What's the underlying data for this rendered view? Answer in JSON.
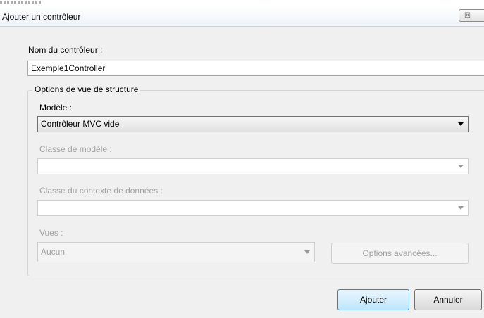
{
  "window": {
    "title": "Ajouter un contrôleur",
    "close_glyph": "☒"
  },
  "controller_name": {
    "label": "Nom du contrôleur :",
    "value": "Exemple1Controller"
  },
  "scaffold_options": {
    "legend": "Options de vue de structure",
    "template": {
      "label": "Modèle :",
      "value": "Contrôleur MVC vide"
    },
    "model_class": {
      "label": "Classe de modèle :",
      "value": ""
    },
    "data_context_class": {
      "label": "Classe du contexte de données :",
      "value": ""
    },
    "views": {
      "label": "Vues :",
      "value": "Aucun"
    },
    "advanced_button": "Options avancées..."
  },
  "buttons": {
    "add": "Ajouter",
    "cancel": "Annuler"
  }
}
